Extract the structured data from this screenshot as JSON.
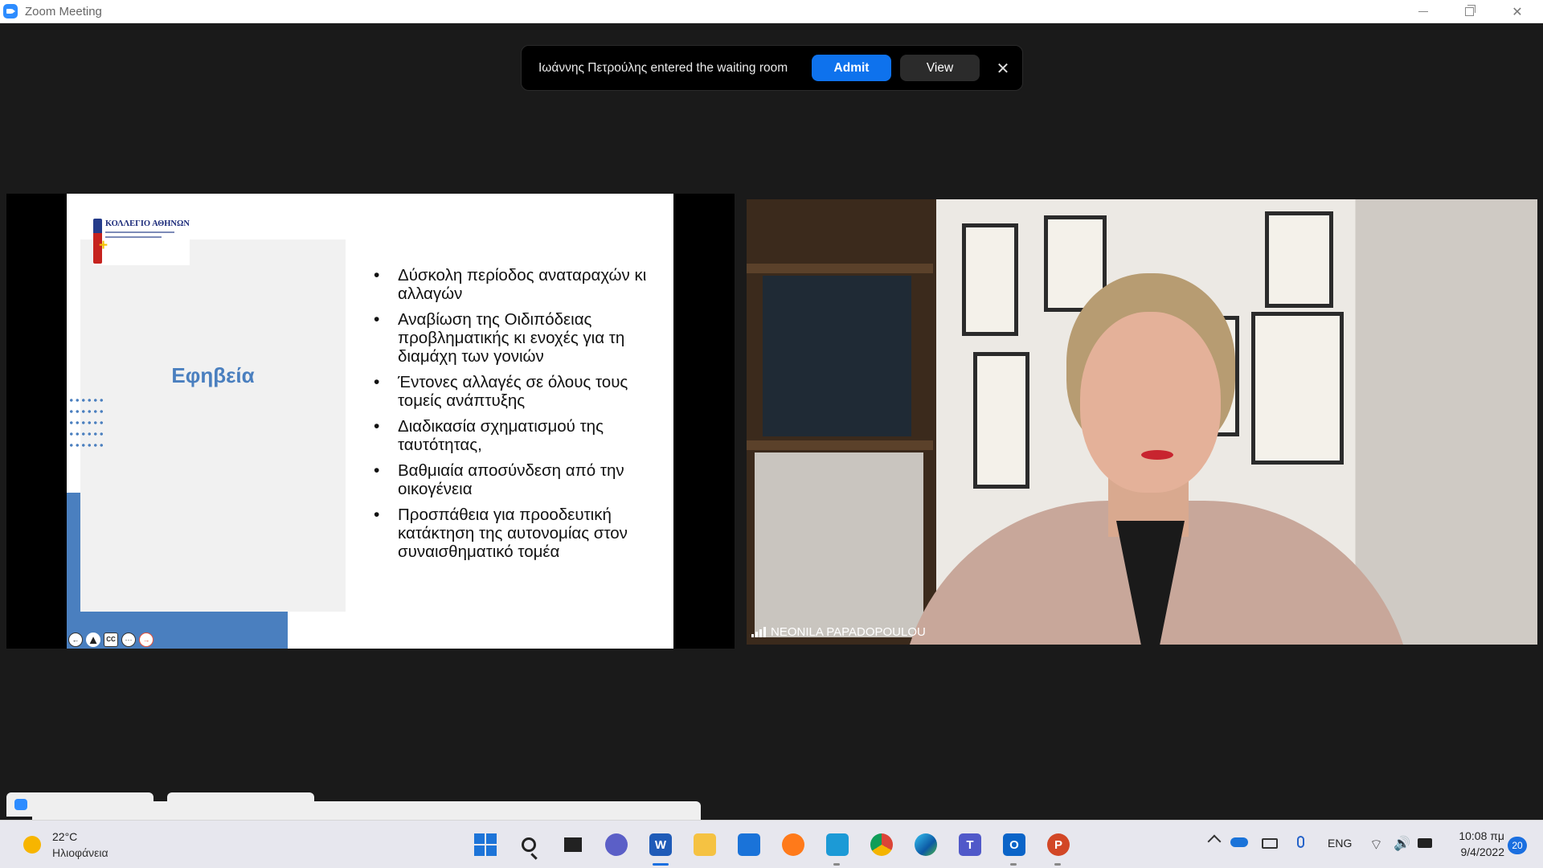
{
  "window": {
    "title": "Zoom Meeting",
    "controls": {
      "minimize": "—",
      "close": "✕"
    }
  },
  "waiting_room": {
    "message": "Ιωάννης Πετρούλης entered the waiting room",
    "admit_label": "Admit",
    "view_label": "View",
    "dismiss_label": "✕"
  },
  "shared_slide": {
    "logo_title": "ΚΟΛΛΕΓΙΟ ΑΘΗΝΩΝ",
    "title": "Εφηβεία",
    "bullets": [
      "Δύσκολη περίοδος αναταραχών κι αλλαγών",
      "Αναβίωση της Οιδιπόδειας προβληματικής κι ενοχές για τη διαμάχη των γονιών",
      "Έντονες αλλαγές σε όλους τους τομείς ανάπτυξης",
      " Διαδικασία σχηματισμού της ταυτότητας,",
      "Βαθμιαία αποσύνδεση από την οικογένεια",
      "Προσπάθεια για προοδευτική κατάκτηση της αυτονομίας στον συναισθηματικό τομέα"
    ],
    "controls": {
      "prev": "←",
      "pen": "▲",
      "cc": "CC",
      "more": "···",
      "next": "→"
    }
  },
  "participant": {
    "name": "NEONILA PAPADOPOULOU"
  },
  "taskbar": {
    "weather": {
      "temp": "22°C",
      "desc": "Ηλιοφάνεια"
    },
    "apps": {
      "word": "W",
      "teams": "T",
      "outlook": "O",
      "powerpoint": "P"
    },
    "tray": {
      "language": "ENG",
      "wifi": "⌔",
      "volume": "🔊"
    },
    "clock": {
      "time": "10:08 πμ",
      "date": "9/4/2022"
    },
    "notifications": "20"
  },
  "colors": {
    "zoom_blue": "#0e72ed",
    "slide_accent": "#4a7fbf",
    "taskbar_bg": "#e7e7ee"
  }
}
